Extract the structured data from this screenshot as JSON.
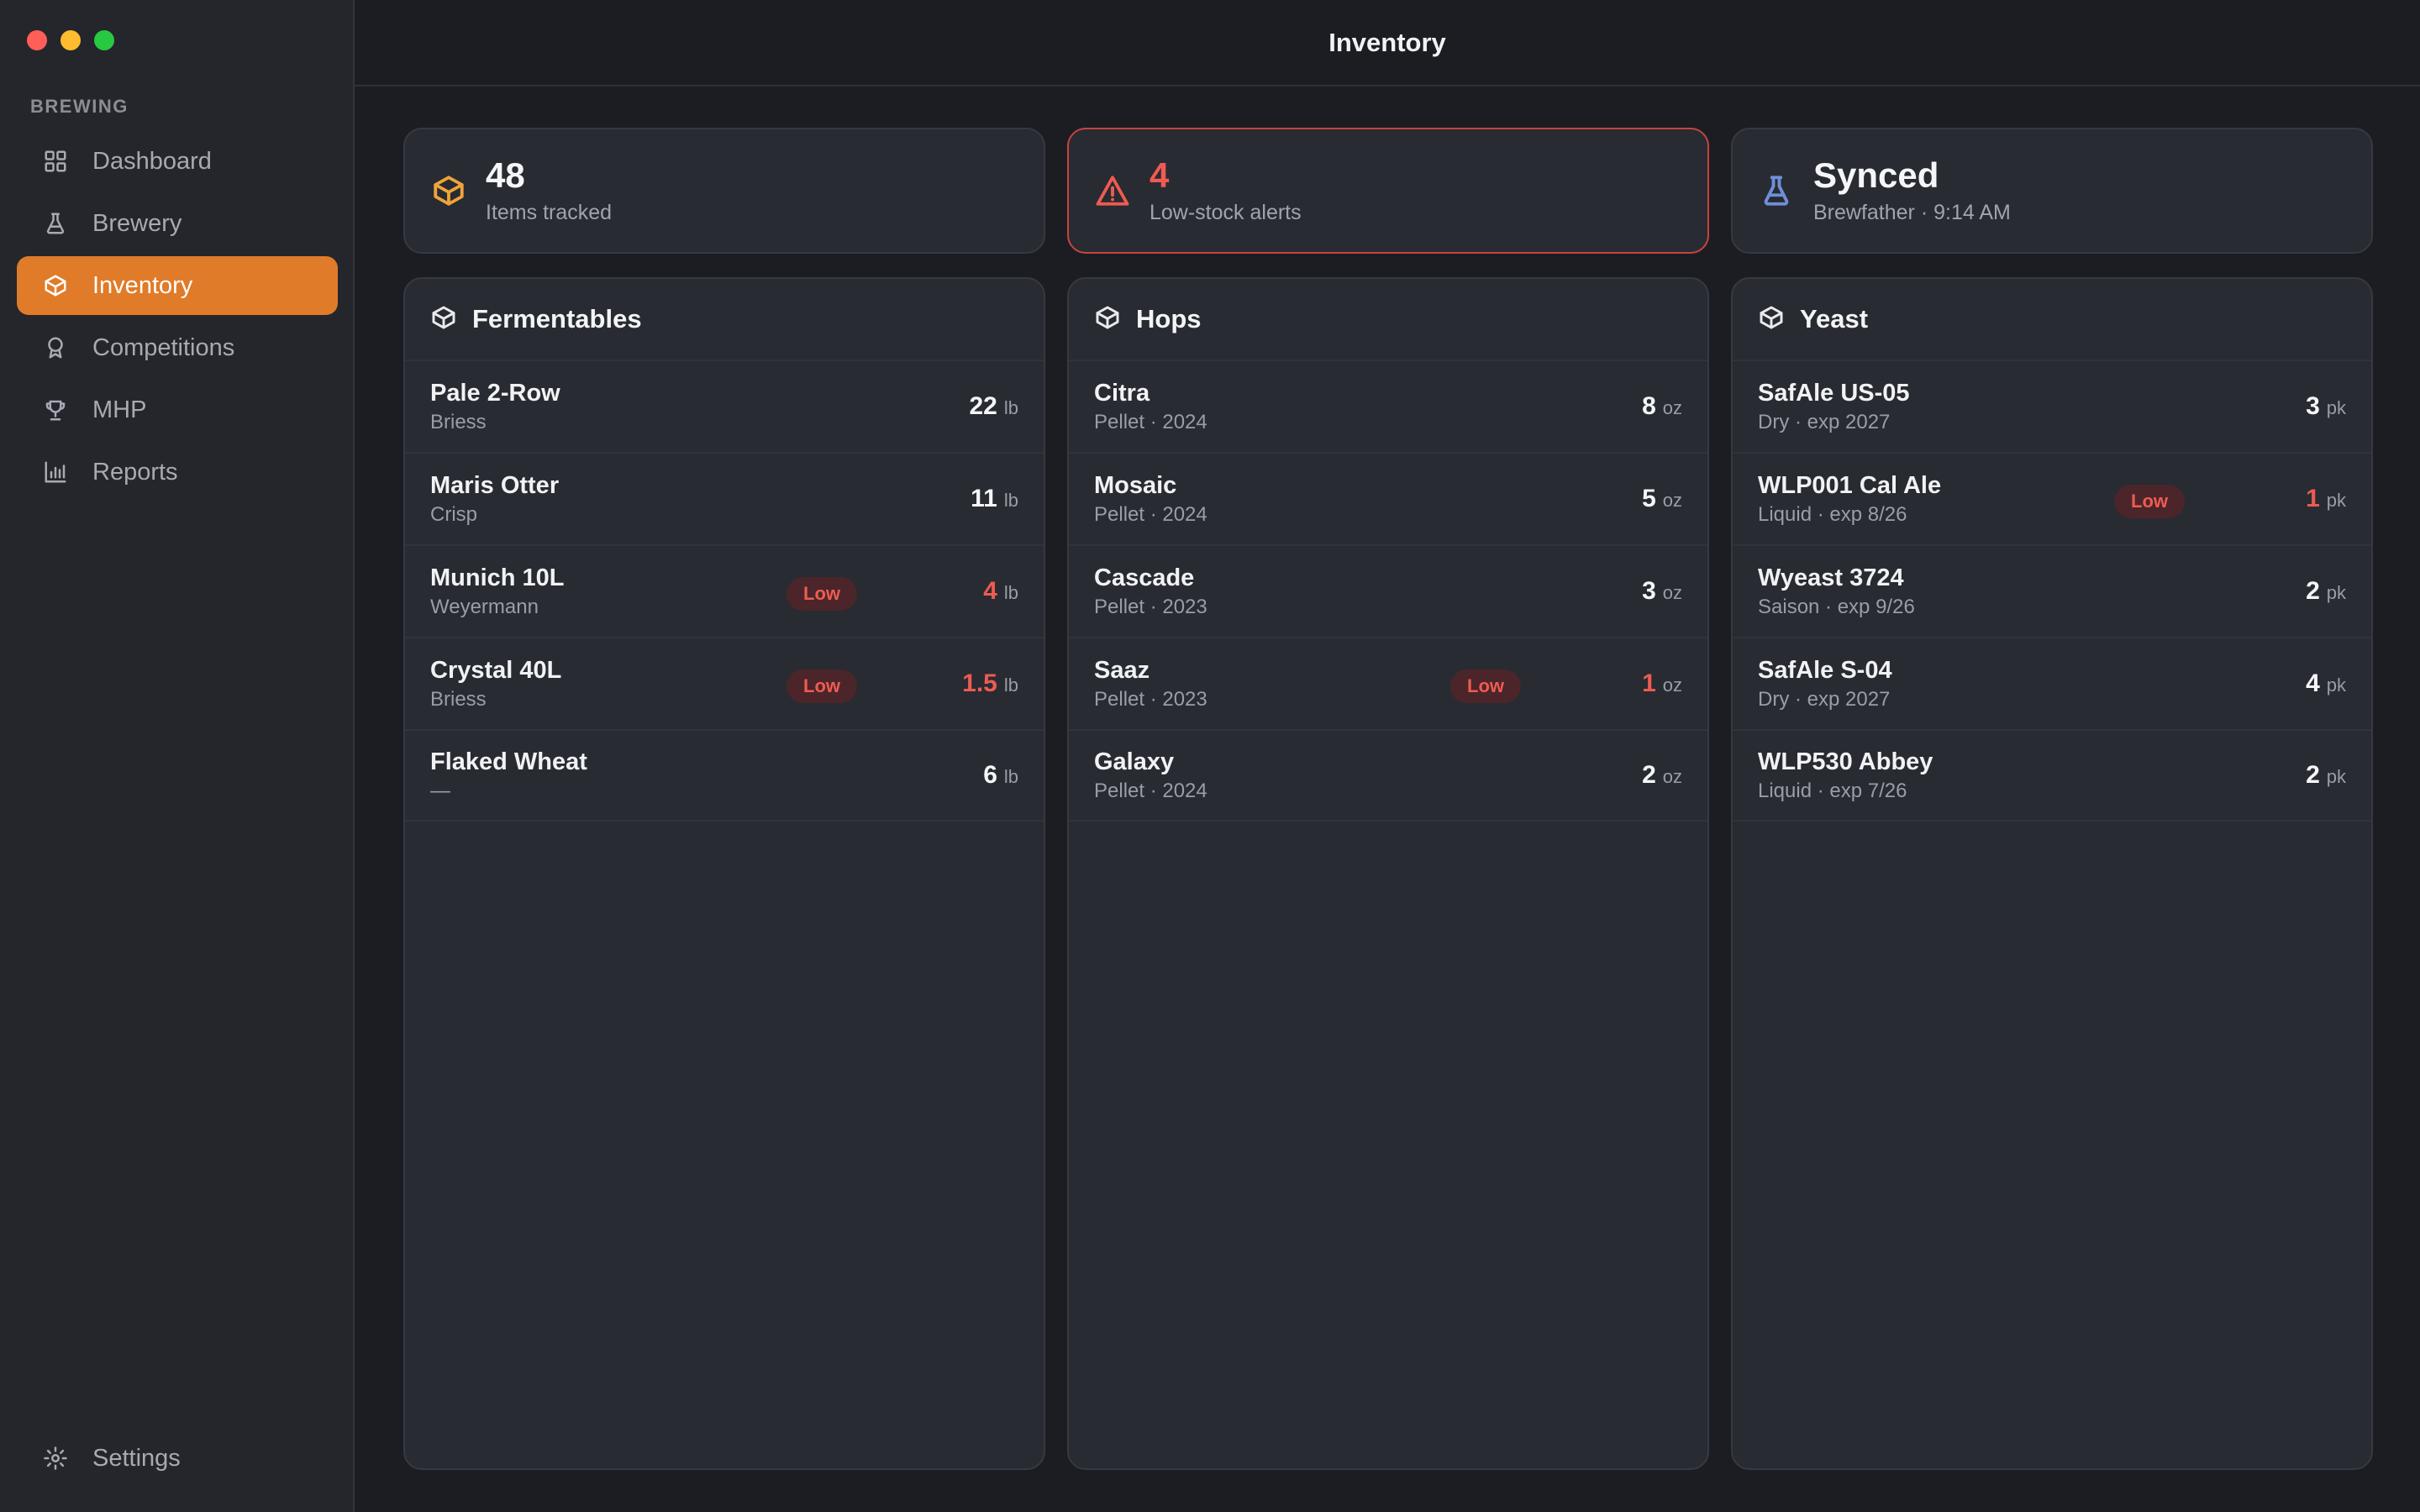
{
  "window": {
    "title": "Inventory"
  },
  "sidebar": {
    "section": "BREWING",
    "items": [
      {
        "label": "Dashboard",
        "icon": "grid-icon"
      },
      {
        "label": "Brewery",
        "icon": "flask-icon"
      },
      {
        "label": "Inventory",
        "icon": "box-icon",
        "active": true
      },
      {
        "label": "Competitions",
        "icon": "award-icon"
      },
      {
        "label": "MHP",
        "icon": "trophy-icon"
      },
      {
        "label": "Reports",
        "icon": "bar-chart-icon"
      }
    ],
    "settings": "Settings"
  },
  "stats": [
    {
      "value": "48",
      "label": "Items tracked",
      "icon": "box-icon",
      "color": "#f0a33a"
    },
    {
      "value": "4",
      "label": "Low-stock alerts",
      "icon": "warning-icon",
      "color": "#ee5b52"
    },
    {
      "value": "Synced",
      "label": "Brewfather · 9:14 AM",
      "icon": "flask-icon",
      "color": "#6f8fd8"
    }
  ],
  "badge_low": "Low",
  "columns": [
    {
      "title": "Fermentables",
      "rows": [
        {
          "name": "Pale 2-Row",
          "sub": "Briess",
          "qty": "22",
          "unit": "lb",
          "low": false
        },
        {
          "name": "Maris Otter",
          "sub": "Crisp",
          "qty": "11",
          "unit": "lb",
          "low": false
        },
        {
          "name": "Munich 10L",
          "sub": "Weyermann",
          "qty": "4",
          "unit": "lb",
          "low": true
        },
        {
          "name": "Crystal 40L",
          "sub": "Briess",
          "qty": "1.5",
          "unit": "lb",
          "low": true
        },
        {
          "name": "Flaked Wheat",
          "sub": "—",
          "qty": "6",
          "unit": "lb",
          "low": false
        }
      ]
    },
    {
      "title": "Hops",
      "rows": [
        {
          "name": "Citra",
          "sub": "Pellet · 2024",
          "qty": "8",
          "unit": "oz",
          "low": false
        },
        {
          "name": "Mosaic",
          "sub": "Pellet · 2024",
          "qty": "5",
          "unit": "oz",
          "low": false
        },
        {
          "name": "Cascade",
          "sub": "Pellet · 2023",
          "qty": "3",
          "unit": "oz",
          "low": false
        },
        {
          "name": "Saaz",
          "sub": "Pellet · 2023",
          "qty": "1",
          "unit": "oz",
          "low": true
        },
        {
          "name": "Galaxy",
          "sub": "Pellet · 2024",
          "qty": "2",
          "unit": "oz",
          "low": false
        }
      ]
    },
    {
      "title": "Yeast",
      "rows": [
        {
          "name": "SafAle US-05",
          "sub": "Dry · exp 2027",
          "qty": "3",
          "unit": "pk",
          "low": false
        },
        {
          "name": "WLP001 Cal Ale",
          "sub": "Liquid · exp 8/26",
          "qty": "1",
          "unit": "pk",
          "low": true
        },
        {
          "name": "Wyeast 3724",
          "sub": "Saison · exp 9/26",
          "qty": "2",
          "unit": "pk",
          "low": false
        },
        {
          "name": "SafAle S-04",
          "sub": "Dry · exp 2027",
          "qty": "4",
          "unit": "pk",
          "low": false
        },
        {
          "name": "WLP530 Abbey",
          "sub": "Liquid · exp 7/26",
          "qty": "2",
          "unit": "pk",
          "low": false
        }
      ]
    }
  ]
}
